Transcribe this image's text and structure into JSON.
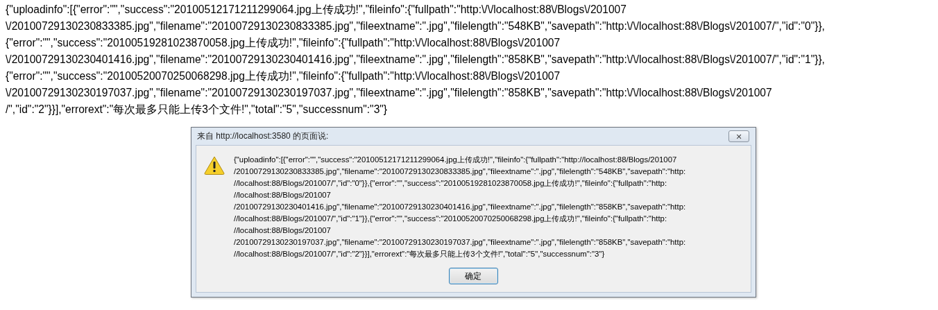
{
  "page_text": {
    "lines": [
      "{\"uploadinfo\":[{\"error\":\"\",\"success\":\"20100512171211299064.jpg上传成功!\",\"fileinfo\":{\"fullpath\":\"http:\\/\\/localhost:88\\/Blogs\\/201007",
      "\\/20100729130230833385.jpg\",\"filename\":\"20100729130230833385.jpg\",\"fileextname\":\".jpg\",\"filelength\":\"548KB\",\"savepath\":\"http:\\/\\/localhost:88\\/Blogs\\/201007/\",\"id\":\"0\"}},",
      "{\"error\":\"\",\"success\":\"20100519281023870058.jpg上传成功!\",\"fileinfo\":{\"fullpath\":\"http:\\/\\/localhost:88\\/Blogs\\/201007",
      "\\/20100729130230401416.jpg\",\"filename\":\"20100729130230401416.jpg\",\"fileextname\":\".jpg\",\"filelength\":\"858KB\",\"savepath\":\"http:\\/\\/localhost:88\\/Blogs\\/201007/\",\"id\":\"1\"}},",
      "{\"error\":\"\",\"success\":\"20100520070250068298.jpg上传成功!\",\"fileinfo\":{\"fullpath\":\"http:\\/\\/localhost:88\\/Blogs\\/201007",
      "\\/20100729130230197037.jpg\",\"filename\":\"20100729130230197037.jpg\",\"fileextname\":\".jpg\",\"filelength\":\"858KB\",\"savepath\":\"http:\\/\\/localhost:88\\/Blogs\\/201007",
      "/\",\"id\":\"2\"}}],\"errorext\":\"每次最多只能上传3个文件!\",\"total\":\"5\",\"successnum\":\"3\"}"
    ]
  },
  "dialog": {
    "title": "来自 http://localhost:3580 的页面说:",
    "close_label": "✕",
    "message_lines": [
      "{\"uploadinfo\":[{\"error\":\"\",\"success\":\"20100512171211299064.jpg上传成功!\",\"fileinfo\":{\"fullpath\":\"http://localhost:88/Blogs/201007",
      "/20100729130230833385.jpg\",\"filename\":\"20100729130230833385.jpg\",\"fileextname\":\".jpg\",\"filelength\":\"548KB\",\"savepath\":\"http:",
      "//localhost:88/Blogs/201007/\",\"id\":\"0\"}},{\"error\":\"\",\"success\":\"20100519281023870058.jpg上传成功!\",\"fileinfo\":{\"fullpath\":\"http:",
      "//localhost:88/Blogs/201007",
      "/20100729130230401416.jpg\",\"filename\":\"20100729130230401416.jpg\",\"fileextname\":\".jpg\",\"filelength\":\"858KB\",\"savepath\":\"http:",
      "//localhost:88/Blogs/201007/\",\"id\":\"1\"}},{\"error\":\"\",\"success\":\"20100520070250068298.jpg上传成功!\",\"fileinfo\":{\"fullpath\":\"http:",
      "//localhost:88/Blogs/201007",
      "/20100729130230197037.jpg\",\"filename\":\"20100729130230197037.jpg\",\"fileextname\":\".jpg\",\"filelength\":\"858KB\",\"savepath\":\"http:",
      "//localhost:88/Blogs/201007/\",\"id\":\"2\"}}],\"errorext\":\"每次最多只能上传3个文件!\",\"total\":\"5\",\"successnum\":\"3\"}"
    ],
    "ok_button": "确定"
  }
}
